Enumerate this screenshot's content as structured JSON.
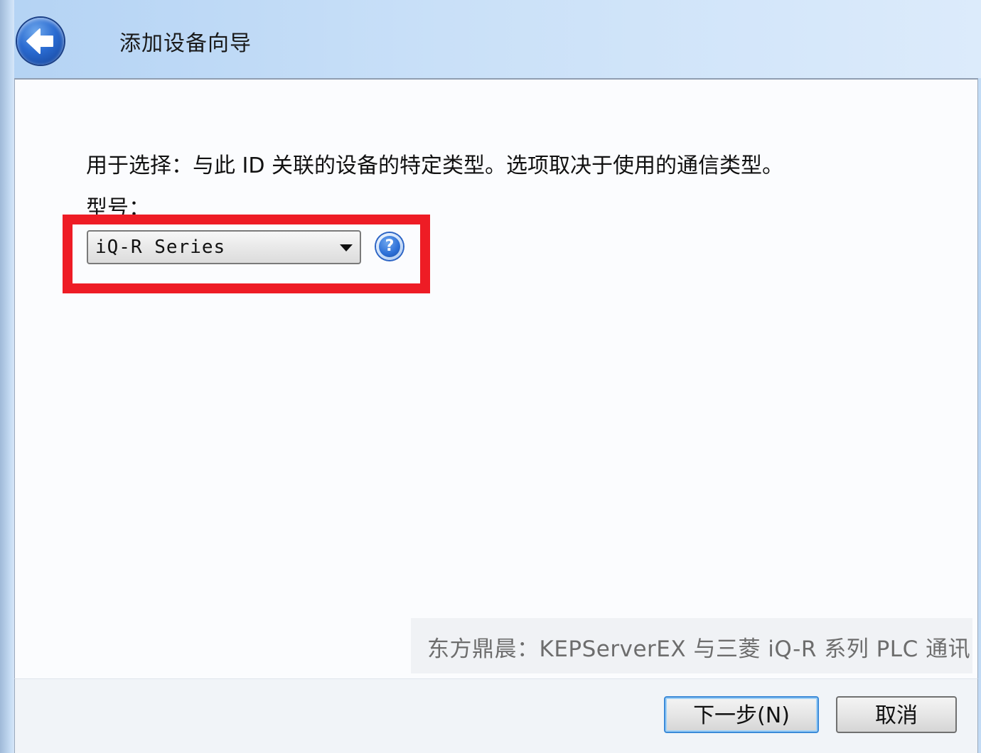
{
  "window": {
    "title": "添加设备向导"
  },
  "header": {
    "back_icon": "back-arrow-icon"
  },
  "main": {
    "description": "用于选择：与此 ID 关联的设备的特定类型。选项取决于使用的通信类型。",
    "model_label": "型号：",
    "model_select": {
      "value": "iQ-R Series"
    },
    "help_icon": "help-question-icon",
    "help_glyph": "?",
    "highlight_color": "#ee1c25"
  },
  "watermark": {
    "text": "东方鼎晨：KEPServerEX 与三菱 iQ-R 系列 PLC 通讯"
  },
  "footer": {
    "next_label": "下一步(N)",
    "cancel_label": "取消"
  }
}
